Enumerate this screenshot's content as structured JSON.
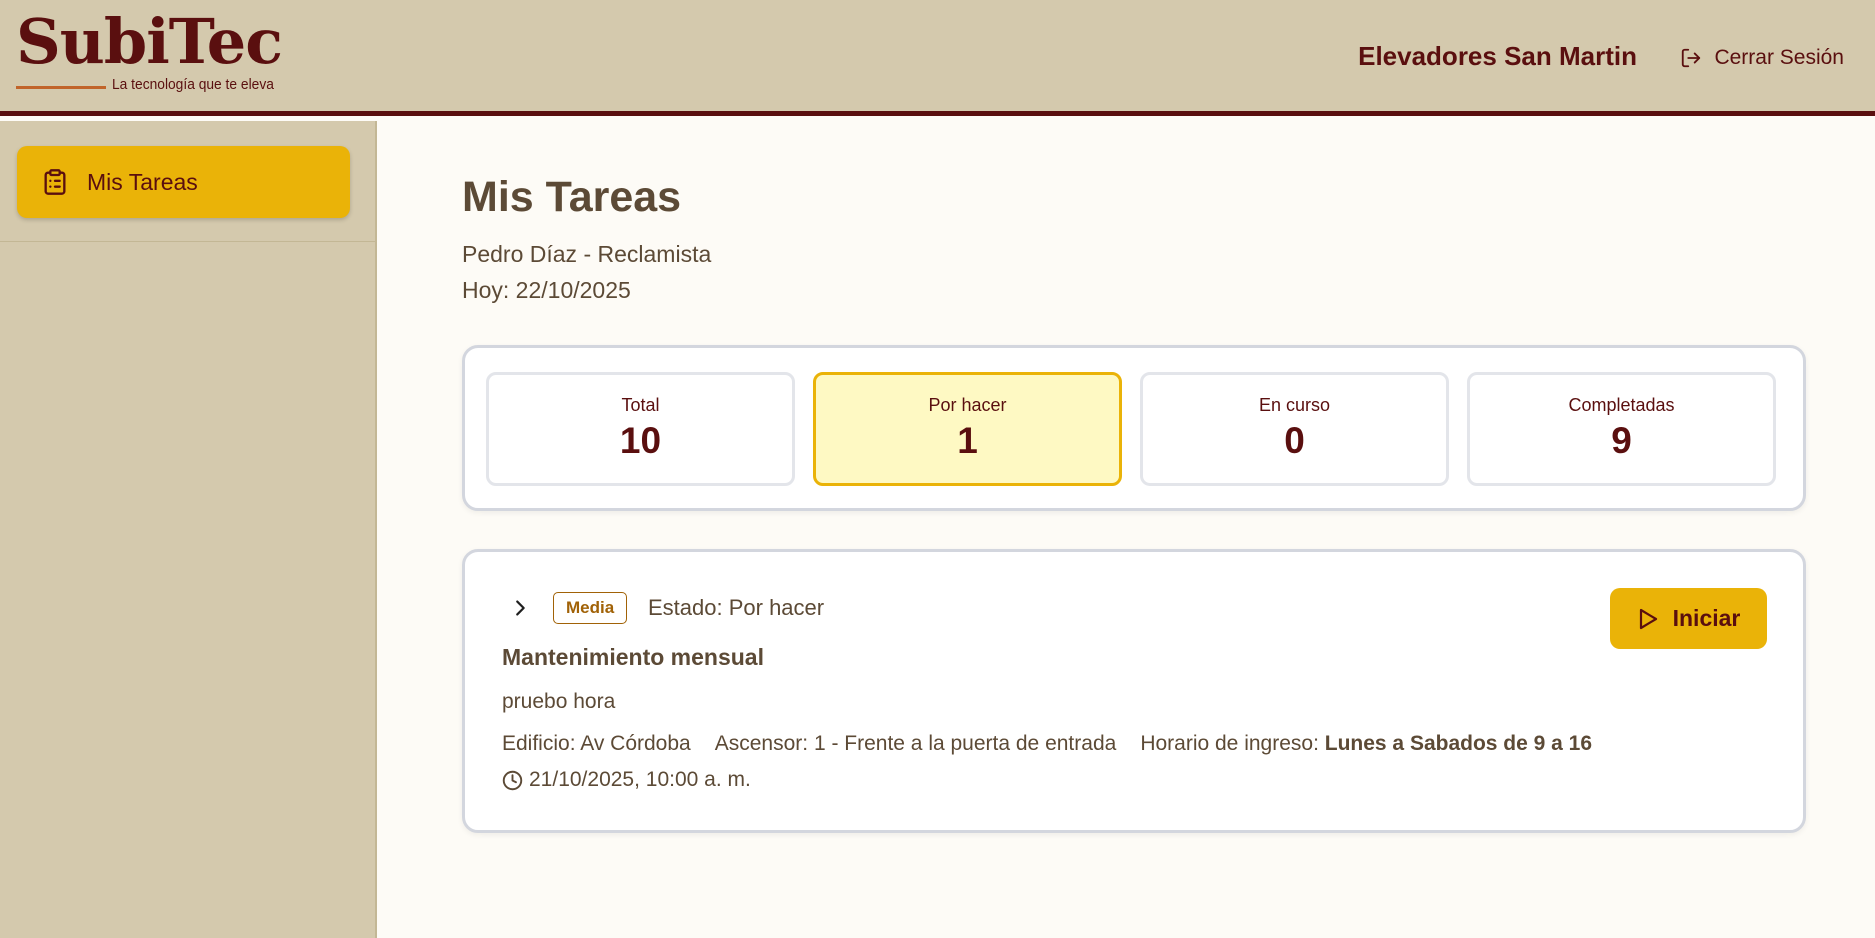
{
  "brand": {
    "name": "SubiTec",
    "tagline": "La tecnología que te eleva"
  },
  "header": {
    "company": "Elevadores San Martin",
    "logout_label": "Cerrar Sesión"
  },
  "sidebar": {
    "items": [
      {
        "label": "Mis Tareas",
        "icon": "clipboard-icon",
        "active": true
      }
    ]
  },
  "main": {
    "title": "Mis Tareas",
    "user": "Pedro Díaz - Reclamista",
    "today": "Hoy: 22/10/2025"
  },
  "stats": [
    {
      "label": "Total",
      "value": "10"
    },
    {
      "label": "Por hacer",
      "value": "1"
    },
    {
      "label": "En curso",
      "value": "0"
    },
    {
      "label": "Completadas",
      "value": "9"
    }
  ],
  "task": {
    "priority": "Media",
    "status": "Estado: Por hacer",
    "title": "Mantenimiento mensual",
    "description": "pruebo hora",
    "building": "Edificio: Av Córdoba",
    "elevator": "Ascensor: 1 - Frente a la puerta de entrada",
    "schedule_label": "Horario de ingreso:",
    "schedule_value": "Lunes a Sabados de 9 a 16",
    "datetime": "21/10/2025, 10:00 a. m.",
    "start_label": "Iniciar"
  },
  "colors": {
    "header_bg": "#d4c9ad",
    "brand_maroon": "#5a0f0f",
    "accent_yellow": "#eab308",
    "active_stat_bg": "#fef9c3",
    "text_brown": "#5c4a36",
    "priority_brown": "#a16207"
  }
}
